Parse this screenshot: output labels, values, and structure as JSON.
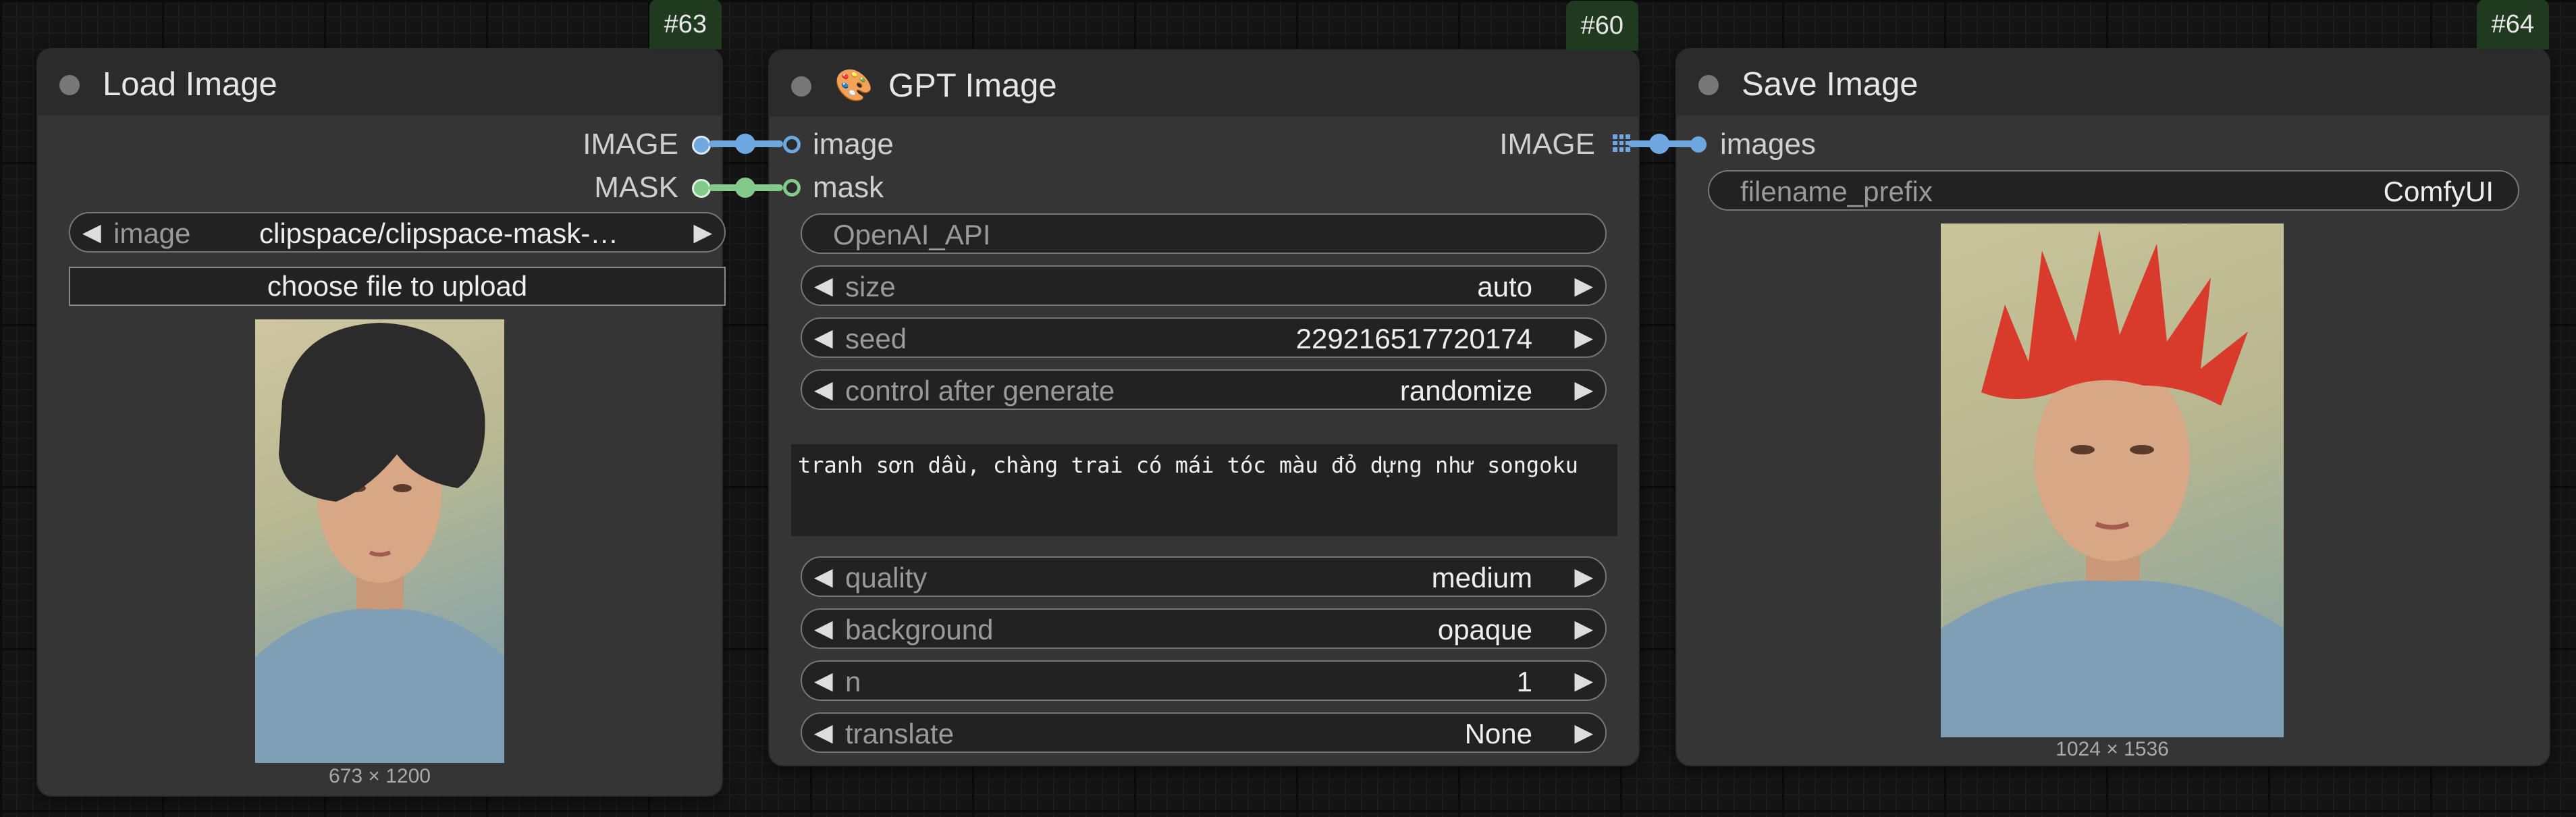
{
  "nodes": {
    "load_image": {
      "id": "#63",
      "title": "Load Image",
      "outputs": [
        "IMAGE",
        "MASK"
      ],
      "image_widget": {
        "name": "image",
        "value": "clipspace/clipspace-mask-…"
      },
      "upload_label": "choose file to upload",
      "image_size": "673 × 1200"
    },
    "gpt_image": {
      "id": "#60",
      "title": "GPT Image",
      "icon": "palette-icon",
      "inputs": [
        "image",
        "mask"
      ],
      "output": "IMAGE",
      "api_field": "OpenAI_API",
      "widgets_top": [
        {
          "name": "size",
          "value": "auto"
        },
        {
          "name": "seed",
          "value": "229216517720174"
        },
        {
          "name": "control after generate",
          "value": "randomize"
        }
      ],
      "prompt": "tranh sơn dầu, chàng trai có mái tóc màu đỏ dựng như songoku",
      "widgets_bottom": [
        {
          "name": "quality",
          "value": "medium"
        },
        {
          "name": "background",
          "value": "opaque"
        },
        {
          "name": "n",
          "value": "1"
        },
        {
          "name": "translate",
          "value": "None"
        }
      ]
    },
    "save_image": {
      "id": "#64",
      "title": "Save Image",
      "input": "images",
      "prefix_widget": {
        "name": "filename_prefix",
        "value": "ComfyUI"
      },
      "image_size": "1024 × 1536"
    }
  },
  "colors": {
    "image_link": "#6fa8e0",
    "mask_link": "#82c98a",
    "node_bg": "#353535",
    "header_bg": "#2b2b2b",
    "badge_bg": "#1f3a1f"
  }
}
